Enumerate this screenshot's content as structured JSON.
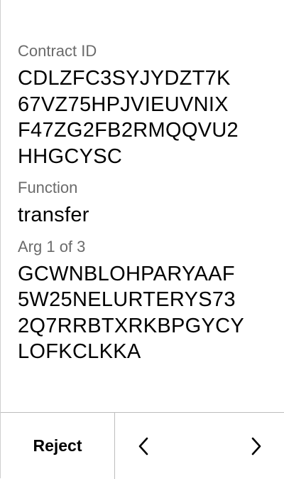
{
  "fields": [
    {
      "label": "Contract ID",
      "value": "CDLZFC3SYJYDZT7K\n67VZ75HPJVIEUVNIX\nF47ZG2FB2RMQQVU2\nHHGCYSC"
    },
    {
      "label": "Function",
      "value": "transfer"
    },
    {
      "label": "Arg 1 of 3",
      "value": "GCWNBLOHPARYAAF\n5W25NELURTERYS73\n2Q7RRBTXRKBPGYCY\nLOFKCLKKA"
    }
  ],
  "footer": {
    "reject_label": "Reject",
    "prev_icon": "chevron-left-icon",
    "next_icon": "chevron-right-icon"
  }
}
